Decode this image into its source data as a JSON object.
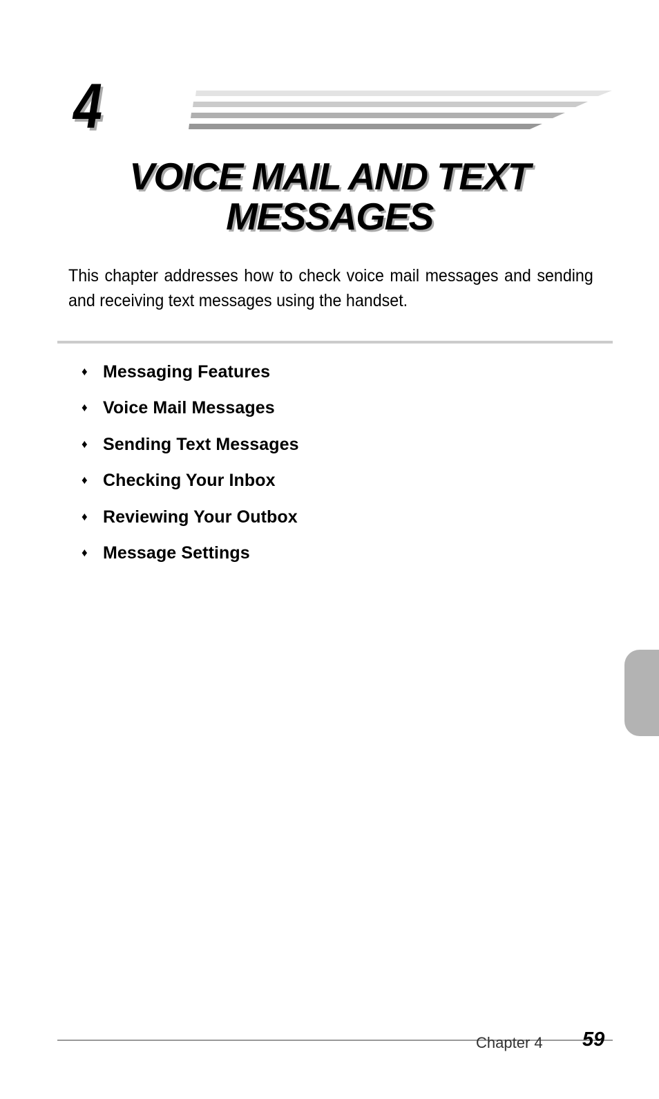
{
  "chapter": {
    "number": "4",
    "title_line1": "VOICE MAIL AND TEXT",
    "title_line2": "MESSAGES",
    "intro": "This chapter addresses how to check voice mail messages and sending and receiving text messages using the handset."
  },
  "stripe_colors": [
    "#e3e3e3",
    "#cbcbcb",
    "#b0b0b0",
    "#979797"
  ],
  "topics": {
    "bullet_icon": "♦",
    "items": [
      {
        "label": "Messaging Features"
      },
      {
        "label": "Voice Mail Messages"
      },
      {
        "label": "Sending Text Messages"
      },
      {
        "label": "Checking Your Inbox"
      },
      {
        "label": "Reviewing Your Outbox"
      },
      {
        "label": "Message Settings"
      }
    ]
  },
  "side_tab_color": "#b3b3b3",
  "footer": {
    "chapter_label": "Chapter 4",
    "page_number": "59"
  }
}
